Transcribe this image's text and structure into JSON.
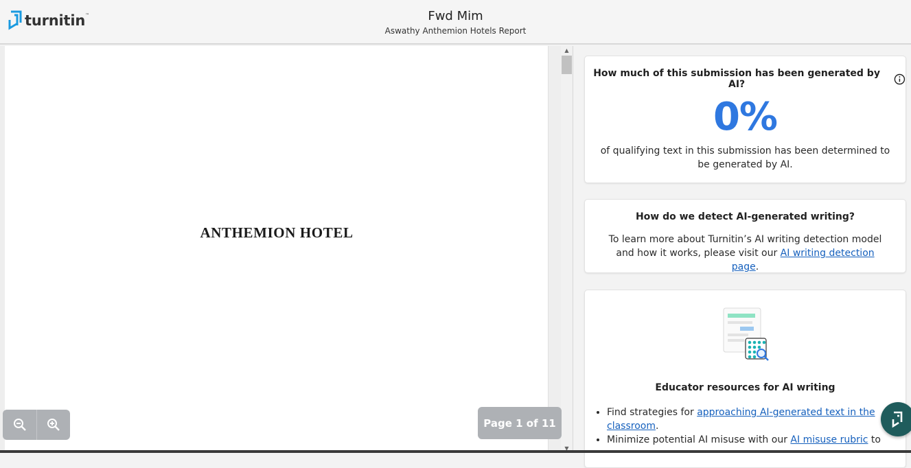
{
  "brand": {
    "name": "turnitin",
    "colors": {
      "accent": "#2f78e0",
      "brand_blue": "#1a9ae0",
      "link": "#1560bd"
    }
  },
  "header": {
    "title": "Fwd Mim",
    "subtitle": "Aswathy Anthemion Hotels Report"
  },
  "viewer": {
    "page_heading": "ANTHEMION HOTEL",
    "page_indicator": "Page 1 of 11",
    "zoom_out_icon": "zoom-out-icon",
    "zoom_in_icon": "zoom-in-icon"
  },
  "ai_score": {
    "question": "How much of this submission has been generated by AI?",
    "percent": "0%",
    "description": "of qualifying text in this submission has been determined to be generated by AI."
  },
  "detect": {
    "title": "How do we detect AI-generated writing?",
    "body_before": "To learn more about Turnitin’s AI writing detection model and how it works, please visit our ",
    "link": "AI writing detection page",
    "body_after": "."
  },
  "resources": {
    "title": "Educator resources for AI writing",
    "item1_before": "Find strategies for ",
    "item1_link": "approaching AI-generated text in the classroom",
    "item1_after": ".",
    "item2_before": "Minimize potential AI misuse with our ",
    "item2_link": "AI misuse rubric",
    "item2_after": " to"
  }
}
